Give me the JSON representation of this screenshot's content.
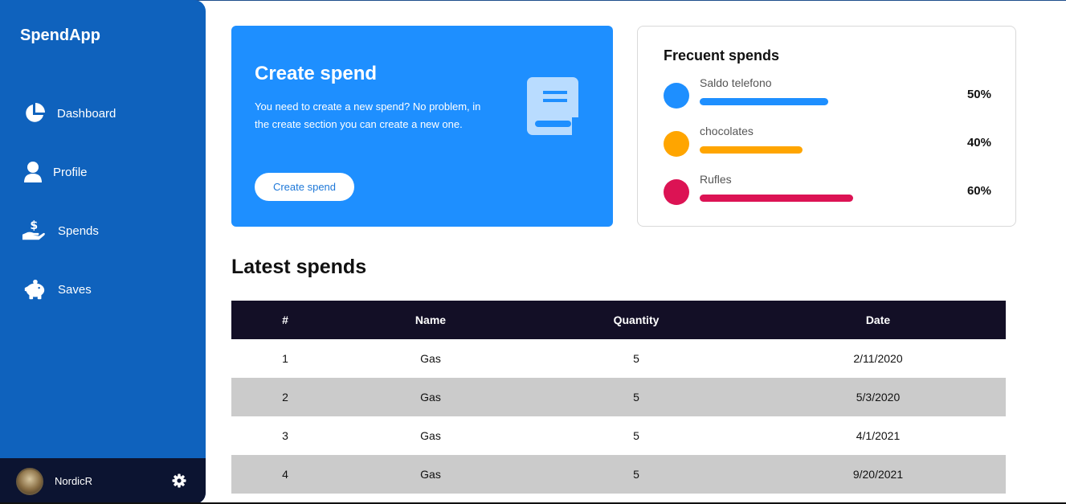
{
  "app": {
    "name": "SpendApp"
  },
  "sidebar": {
    "items": [
      {
        "label": "Dashboard",
        "icon": "pie-chart-icon"
      },
      {
        "label": "Profile",
        "icon": "user-icon"
      },
      {
        "label": "Spends",
        "icon": "hand-dollar-icon"
      },
      {
        "label": "Saves",
        "icon": "piggy-bank-icon"
      }
    ],
    "user": {
      "name": "NordicR",
      "settings_icon": "gear-icon"
    }
  },
  "create_card": {
    "title": "Create spend",
    "description": "You need to create a new spend? No problem, in the create section you can create a new one.",
    "button_label": "Create spend",
    "icon": "book-icon"
  },
  "frequent": {
    "title": "Frecuent spends",
    "items": [
      {
        "name": "Saldo telefono",
        "percent_label": "50%",
        "percent": 50,
        "color": "#1e8fff"
      },
      {
        "name": "chocolates",
        "percent_label": "40%",
        "percent": 40,
        "color": "#ffa500"
      },
      {
        "name": "Rufles",
        "percent_label": "60%",
        "percent": 60,
        "color": "#dc1354"
      }
    ]
  },
  "latest": {
    "title": "Latest spends",
    "columns": [
      "#",
      "Name",
      "Quantity",
      "Date"
    ],
    "rows": [
      [
        "1",
        "Gas",
        "5",
        "2/11/2020"
      ],
      [
        "2",
        "Gas",
        "5",
        "5/3/2020"
      ],
      [
        "3",
        "Gas",
        "5",
        "4/1/2021"
      ],
      [
        "4",
        "Gas",
        "5",
        "9/20/2021"
      ]
    ]
  },
  "colors": {
    "sidebar": "#0f62bd",
    "accent": "#1e8fff",
    "table_header": "#130f26",
    "user_bar": "#0c1431"
  }
}
